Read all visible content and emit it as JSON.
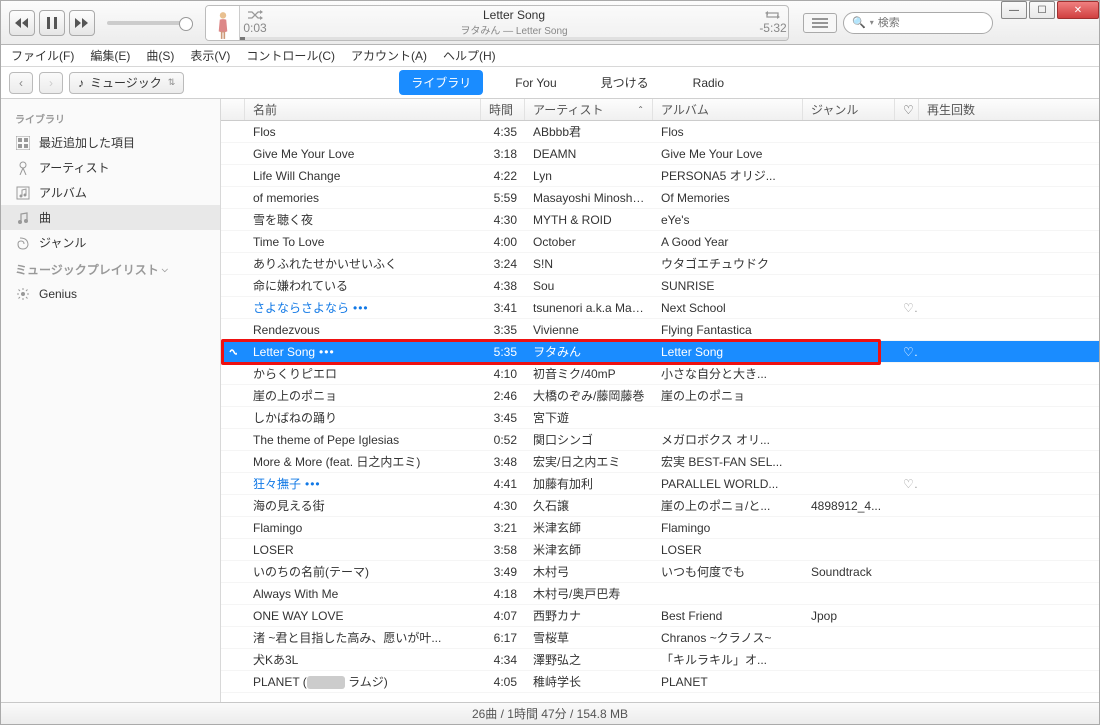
{
  "now_playing": {
    "title": "Letter Song",
    "subtitle": "ヲタみん — Letter Song",
    "elapsed": "0:03",
    "remaining": "-5:32"
  },
  "search": {
    "placeholder": "検索"
  },
  "menu": [
    "ファイル(F)",
    "編集(E)",
    "曲(S)",
    "表示(V)",
    "コントロール(C)",
    "アカウント(A)",
    "ヘルプ(H)"
  ],
  "picker": {
    "label": "ミュージック"
  },
  "tabs": [
    {
      "label": "ライブラリ",
      "active": true
    },
    {
      "label": "For You",
      "active": false
    },
    {
      "label": "見つける",
      "active": false
    },
    {
      "label": "Radio",
      "active": false
    }
  ],
  "sidebar": {
    "header1": "ライブラリ",
    "items1": [
      {
        "label": "最近追加した項目",
        "icon": "recent"
      },
      {
        "label": "アーティスト",
        "icon": "mic"
      },
      {
        "label": "アルバム",
        "icon": "album"
      },
      {
        "label": "曲",
        "icon": "note",
        "active": true
      },
      {
        "label": "ジャンル",
        "icon": "genre"
      }
    ],
    "header2": "ミュージックプレイリスト",
    "items2": [
      {
        "label": "Genius",
        "icon": "genius"
      }
    ]
  },
  "columns": {
    "icon": "",
    "name": "名前",
    "time": "時間",
    "artist": "アーティスト",
    "album": "アルバム",
    "genre": "ジャンル",
    "heart": "♡",
    "plays": "再生回数"
  },
  "tracks": [
    {
      "name": "Flos",
      "time": "4:35",
      "artist": "ABbbb君",
      "album": "Flos",
      "genre": "",
      "heart": "",
      "blue": false
    },
    {
      "name": "Give Me Your Love",
      "time": "3:18",
      "artist": "DEAMN",
      "album": "Give Me Your Love",
      "genre": "",
      "heart": "",
      "blue": false
    },
    {
      "name": "Life Will Change",
      "time": "4:22",
      "artist": "Lyn",
      "album": "PERSONA5 オリジ...",
      "genre": "",
      "heart": "",
      "blue": false
    },
    {
      "name": "of memories",
      "time": "5:59",
      "artist": "Masayoshi Minoshi...",
      "album": "Of Memories",
      "genre": "",
      "heart": "",
      "blue": false
    },
    {
      "name": "雪を聴く夜",
      "time": "4:30",
      "artist": "MYTH & ROID",
      "album": "eYe's",
      "genre": "",
      "heart": "",
      "blue": false
    },
    {
      "name": "Time To Love",
      "time": "4:00",
      "artist": "October",
      "album": "A Good Year",
      "genre": "",
      "heart": "",
      "blue": false
    },
    {
      "name": "ありふれたせかいせいふく",
      "time": "3:24",
      "artist": "S!N",
      "album": "ウタゴエチュウドク",
      "genre": "",
      "heart": "",
      "blue": false
    },
    {
      "name": "命に嫌われている",
      "time": "4:38",
      "artist": "Sou",
      "album": "SUNRISE",
      "genre": "",
      "heart": "",
      "blue": false
    },
    {
      "name": "さよならさよなら",
      "dots": true,
      "time": "3:41",
      "artist": "tsunenori a.k.a Mar...",
      "album": "Next School",
      "genre": "",
      "heart": "♡",
      "blue": true
    },
    {
      "name": "Rendezvous",
      "time": "3:35",
      "artist": "Vivienne",
      "album": "Flying Fantastica",
      "genre": "",
      "heart": "",
      "blue": false
    },
    {
      "name": "Letter Song",
      "dots": true,
      "time": "5:35",
      "artist": "ヲタみん",
      "album": "Letter Song",
      "genre": "",
      "heart": "♡",
      "playing": true,
      "selected": true
    },
    {
      "name": "からくりピエロ",
      "time": "4:10",
      "artist": "初音ミク/40mP",
      "album": "小さな自分と大き...",
      "genre": "",
      "heart": ""
    },
    {
      "name": "崖の上のポニョ",
      "time": "2:46",
      "artist": "大橋のぞみ/藤岡藤巻",
      "album": "崖の上のポニョ",
      "genre": "",
      "heart": ""
    },
    {
      "name": "しかばねの踊り",
      "time": "3:45",
      "artist": "宮下遊",
      "album": "",
      "genre": "",
      "heart": ""
    },
    {
      "name": "The theme of Pepe Iglesias",
      "time": "0:52",
      "artist": "関口シンゴ",
      "album": "メガロボクス オリ...",
      "genre": "",
      "heart": ""
    },
    {
      "name": "More & More (feat. 日之内エミ)",
      "time": "3:48",
      "artist": "宏実/日之内エミ",
      "album": "宏実 BEST-FAN SEL...",
      "genre": "",
      "heart": ""
    },
    {
      "name": "狂々撫子",
      "dots": true,
      "time": "4:41",
      "artist": "加藤有加利",
      "album": "PARALLEL WORLD...",
      "genre": "",
      "heart": "♡",
      "blue": true
    },
    {
      "name": "海の見える街",
      "time": "4:30",
      "artist": "久石譲",
      "album": "崖の上のポニョ/と...",
      "genre": "4898912_4...",
      "heart": ""
    },
    {
      "name": "Flamingo",
      "time": "3:21",
      "artist": "米津玄師",
      "album": "Flamingo",
      "genre": "",
      "heart": ""
    },
    {
      "name": "LOSER",
      "time": "3:58",
      "artist": "米津玄師",
      "album": "LOSER",
      "genre": "",
      "heart": ""
    },
    {
      "name": "いのちの名前(テーマ)",
      "time": "3:49",
      "artist": "木村弓",
      "album": "いつも何度でも",
      "genre": "Soundtrack",
      "heart": ""
    },
    {
      "name": "Always With Me",
      "time": "4:18",
      "artist": "木村弓/奥戸巴寿",
      "album": "",
      "genre": "",
      "heart": ""
    },
    {
      "name": "ONE WAY LOVE",
      "time": "4:07",
      "artist": "西野カナ",
      "album": "Best Friend",
      "genre": "Jpop",
      "heart": ""
    },
    {
      "name": "渚 ~君と目指した高み、愿いが叶...",
      "time": "6:17",
      "artist": "雪桜草",
      "album": "Chranos ~クラノス~",
      "genre": "",
      "heart": ""
    },
    {
      "name": "犬Kあ3L",
      "time": "4:34",
      "artist": "澤野弘之",
      "album": "「キルラキル」オ...",
      "genre": "",
      "heart": ""
    },
    {
      "name": "PLANET (          ラムジ)",
      "pill": true,
      "time": "4:05",
      "artist": "稚峙学长",
      "album": "PLANET",
      "genre": "",
      "heart": ""
    }
  ],
  "status": "26曲 / 1時間 47分 / 154.8 MB"
}
